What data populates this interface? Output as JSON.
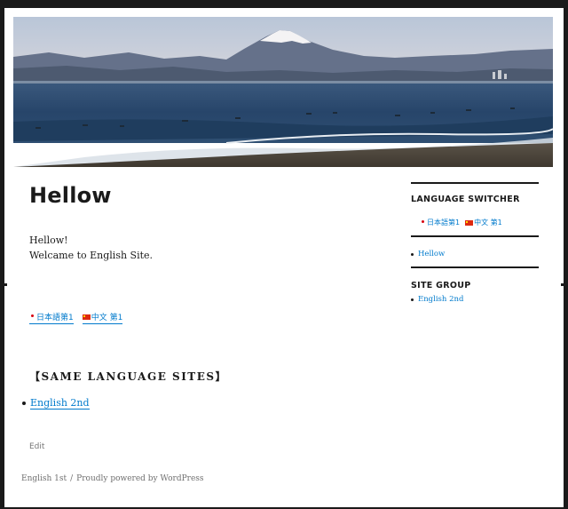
{
  "post": {
    "title": "Hellow",
    "content_line1": "Hellow!",
    "content_line2": "Welcame to English Site.",
    "edit_label": "Edit"
  },
  "inline_languages": [
    {
      "label": "日本語第1",
      "flag": "jp-flag-icon"
    },
    {
      "label": "中文 第1",
      "flag": "cn-flag-icon"
    }
  ],
  "same_language": {
    "heading": "【SAME LANGUAGE SITES】",
    "items": [
      "English 2nd"
    ]
  },
  "sidebar": {
    "switcher_title": "LANGUAGE SWITCHER",
    "switcher_links": [
      {
        "label": "日本語第1",
        "flag": "jp-flag-icon"
      },
      {
        "label": "中文 第1",
        "flag": "cn-flag-icon"
      }
    ],
    "recent_posts": [
      "Hellow"
    ],
    "site_group_title": "SITE GROUP",
    "site_group": [
      "English 2nd"
    ]
  },
  "footer": {
    "site_name": "English 1st",
    "separator": "/",
    "powered_by": "Proudly powered by WordPress"
  },
  "colors": {
    "link": "#007acc",
    "text": "#1a1a1a",
    "page_bg": "#1a1a1a",
    "content_bg": "#ffffff"
  }
}
